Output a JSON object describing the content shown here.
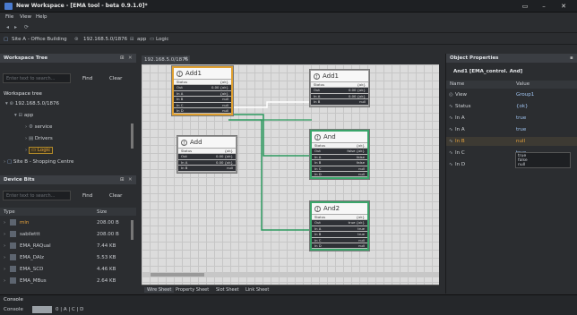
{
  "window": {
    "title": "New Workspace - [EMA tool - beta 0.9.1.0]*"
  },
  "menu": [
    "File",
    "View",
    "Help"
  ],
  "breadcrumb": [
    "Site A - Office Building",
    "192.168.5.0/1876",
    "app",
    "Logic"
  ],
  "workspace_tree": {
    "title": "Workspace Tree",
    "search_placeholder": "Enter text to search...",
    "find_label": "Find",
    "clear_label": "Clear",
    "root": "Workspace tree",
    "items": [
      {
        "label": "192.168.5.0/1876",
        "depth": 0
      },
      {
        "label": "app",
        "depth": 1
      },
      {
        "label": "service",
        "depth": 2
      },
      {
        "label": "Drivers",
        "depth": 2
      },
      {
        "label": "Logic",
        "depth": 2,
        "selected": true
      },
      {
        "label": "Site B - Shopping Centre",
        "depth": -1
      }
    ]
  },
  "device_bits": {
    "title": "Device Bits",
    "search_placeholder": "Enter text to search...",
    "find_label": "Find",
    "clear_label": "Clear",
    "col_type": "Type",
    "col_size": "Size",
    "rows": [
      {
        "name": "min",
        "size": "208.00 B",
        "highlight": true
      },
      {
        "name": "sabilettt",
        "size": "208.00 B"
      },
      {
        "name": "EMA_RAQual",
        "size": "7.44 KB"
      },
      {
        "name": "EMA_DAlz",
        "size": "5.53 KB"
      },
      {
        "name": "EMA_SCD",
        "size": "4.46 KB"
      },
      {
        "name": "EMA_MBus",
        "size": "2.64 KB"
      }
    ]
  },
  "editor": {
    "tab": "192.168.5.0/1876",
    "sheet_tabs": [
      "Wire Sheet",
      "Property Sheet",
      "Slot Sheet",
      "Link Sheet"
    ]
  },
  "nodes": [
    {
      "id": "add1",
      "title": "Add1",
      "rows": [
        [
          "Status",
          "{ok}"
        ],
        [
          "Out",
          "0.00 {ok}"
        ],
        [
          "In A",
          "{ok}"
        ],
        [
          "In B",
          "null"
        ],
        [
          "In C",
          "null"
        ],
        [
          "In D",
          "null"
        ]
      ]
    },
    {
      "id": "add",
      "title": "Add",
      "rows": [
        [
          "Status",
          "{ok}"
        ],
        [
          "Out",
          "0.00 {ok}"
        ],
        [
          "In A",
          "0.00 {ok}"
        ],
        [
          "In B",
          "null"
        ]
      ]
    },
    {
      "id": "add1b",
      "title": "Add1",
      "rows": [
        [
          "Status",
          "{ok}"
        ],
        [
          "Out",
          "0.00 {ok}"
        ],
        [
          "In A",
          "0.00 {ok}"
        ],
        [
          "In B",
          "null"
        ]
      ]
    },
    {
      "id": "and",
      "title": "And",
      "rows": [
        [
          "Status",
          "{ok}"
        ],
        [
          "Out",
          "false {ok}"
        ],
        [
          "In A",
          "false"
        ],
        [
          "In B",
          "false"
        ],
        [
          "In C",
          "null"
        ],
        [
          "In D",
          "null"
        ]
      ]
    },
    {
      "id": "and2",
      "title": "And2",
      "rows": [
        [
          "Status",
          "{ok}"
        ],
        [
          "Out",
          "true {ok}"
        ],
        [
          "In A",
          "true"
        ],
        [
          "In B",
          "true"
        ],
        [
          "In C",
          "null"
        ],
        [
          "In D",
          "null"
        ]
      ]
    }
  ],
  "properties": {
    "title": "Object Properties",
    "subtitle": "And1 [EMA_control. And]",
    "col_name": "Name",
    "col_value": "Value",
    "rows": [
      {
        "name": "View",
        "value": "Group1"
      },
      {
        "name": "Status",
        "value": "{ok}"
      },
      {
        "name": "In A",
        "value": "true"
      },
      {
        "name": "In A",
        "value": "true"
      },
      {
        "name": "In B",
        "value": "null",
        "highlight": true
      },
      {
        "name": "In C",
        "value": "true"
      },
      {
        "name": "In D",
        "value": "null"
      }
    ],
    "dropdown_options": [
      "true",
      "false",
      "null"
    ]
  },
  "console": {
    "title": "Console",
    "prompt": "Console",
    "input": "0 | A | C | D"
  }
}
